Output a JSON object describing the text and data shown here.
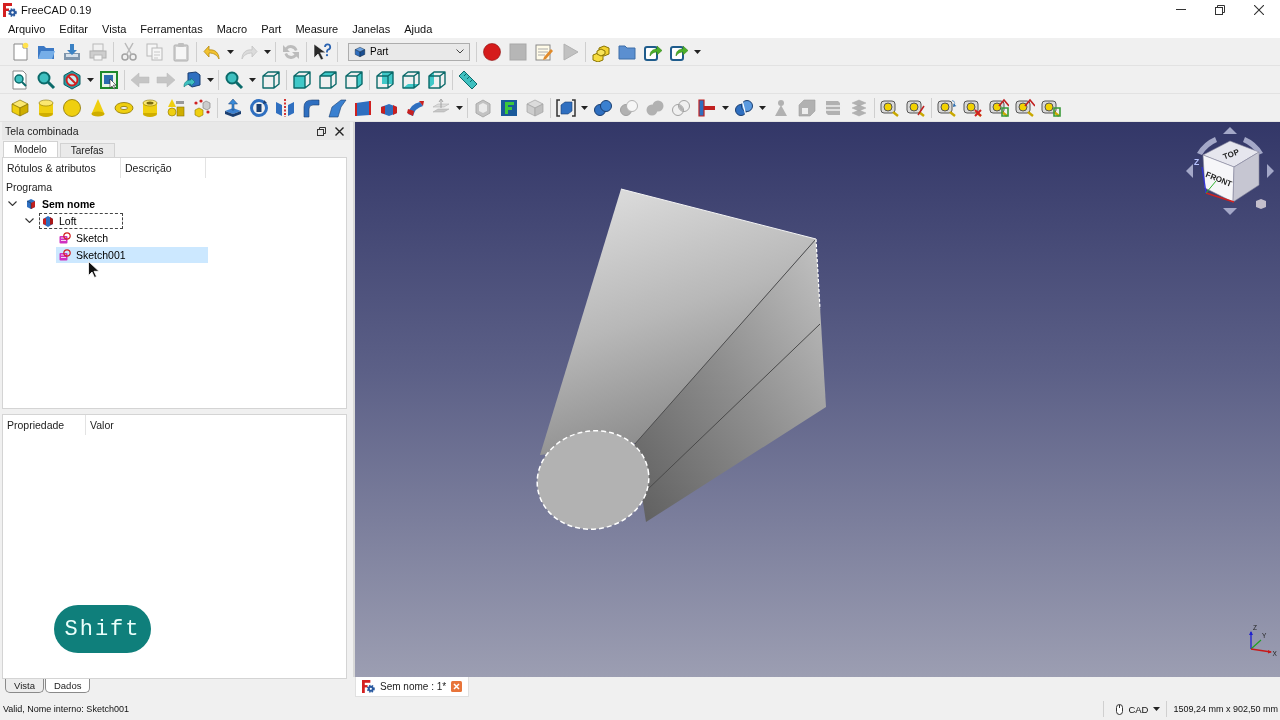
{
  "window": {
    "title": "FreeCAD 0.19"
  },
  "menu": [
    "Arquivo",
    "Editar",
    "Vista",
    "Ferramentas",
    "Macro",
    "Part",
    "Measure",
    "Janelas",
    "Ajuda"
  ],
  "toolbars": [
    {
      "groups": [
        {
          "kind": "tools",
          "items": [
            {
              "disabled": false,
              "dropdown": false
            },
            {
              "disabled": false,
              "dropdown": false
            },
            {
              "disabled": false,
              "dropdown": false
            },
            {
              "disabled": true,
              "dropdown": false
            }
          ]
        },
        {
          "kind": "tools",
          "items": [
            {
              "disabled": true,
              "dropdown": false
            },
            {
              "disabled": true,
              "dropdown": false
            },
            {
              "disabled": true,
              "dropdown": false
            }
          ]
        },
        {
          "kind": "tools",
          "items": [
            {
              "disabled": false,
              "dropdown": true
            },
            {
              "disabled": true,
              "dropdown": true
            }
          ]
        },
        {
          "kind": "tools",
          "items": [
            {
              "disabled": true,
              "dropdown": false
            }
          ]
        },
        {
          "kind": "tools",
          "items": [
            {
              "disabled": false,
              "dropdown": false
            }
          ]
        },
        {
          "kind": "combo",
          "value": "Part"
        },
        {
          "kind": "tools",
          "items": [
            {
              "disabled": false,
              "dropdown": false
            },
            {
              "disabled": true,
              "dropdown": false
            },
            {
              "disabled": false,
              "dropdown": false
            },
            {
              "disabled": true,
              "dropdown": false
            }
          ]
        },
        {
          "kind": "tools",
          "items": [
            {
              "disabled": false,
              "dropdown": false
            },
            {
              "disabled": false,
              "dropdown": false
            },
            {
              "disabled": false,
              "dropdown": false
            },
            {
              "disabled": false,
              "dropdown": true
            }
          ]
        }
      ]
    },
    {
      "groups": [
        {
          "kind": "tools",
          "items": [
            {
              "disabled": false,
              "dropdown": false
            },
            {
              "disabled": false,
              "dropdown": false
            },
            {
              "disabled": false,
              "dropdown": true
            },
            {
              "disabled": false,
              "dropdown": false
            }
          ]
        },
        {
          "kind": "tools",
          "items": [
            {
              "disabled": true,
              "dropdown": false
            },
            {
              "disabled": true,
              "dropdown": false
            },
            {
              "disabled": false,
              "dropdown": true
            }
          ]
        },
        {
          "kind": "tools",
          "items": [
            {
              "disabled": false,
              "dropdown": true
            },
            {
              "disabled": false,
              "dropdown": false
            }
          ]
        },
        {
          "kind": "tools",
          "items": [
            {
              "disabled": false,
              "dropdown": false
            },
            {
              "disabled": false,
              "dropdown": false
            },
            {
              "disabled": false,
              "dropdown": false
            }
          ]
        },
        {
          "kind": "tools",
          "items": [
            {
              "disabled": false,
              "dropdown": false
            },
            {
              "disabled": false,
              "dropdown": false
            },
            {
              "disabled": false,
              "dropdown": false
            }
          ]
        },
        {
          "kind": "tools",
          "items": [
            {
              "disabled": false,
              "dropdown": false
            }
          ]
        }
      ]
    },
    {
      "groups": [
        {
          "kind": "tools",
          "items": [
            {
              "disabled": false,
              "dropdown": false
            },
            {
              "disabled": false,
              "dropdown": false
            },
            {
              "disabled": false,
              "dropdown": false
            },
            {
              "disabled": false,
              "dropdown": false
            },
            {
              "disabled": false,
              "dropdown": false
            },
            {
              "disabled": false,
              "dropdown": false
            },
            {
              "disabled": false,
              "dropdown": false
            },
            {
              "disabled": false,
              "dropdown": false
            }
          ]
        },
        {
          "kind": "tools",
          "items": [
            {
              "disabled": false,
              "dropdown": false
            },
            {
              "disabled": false,
              "dropdown": false
            },
            {
              "disabled": false,
              "dropdown": false
            },
            {
              "disabled": false,
              "dropdown": false
            },
            {
              "disabled": false,
              "dropdown": false
            },
            {
              "disabled": false,
              "dropdown": false
            },
            {
              "disabled": false,
              "dropdown": false
            },
            {
              "disabled": false,
              "dropdown": false
            },
            {
              "disabled": true,
              "dropdown": true
            }
          ]
        },
        {
          "kind": "tools",
          "items": [
            {
              "disabled": true,
              "dropdown": false
            },
            {
              "disabled": false,
              "dropdown": false
            },
            {
              "disabled": true,
              "dropdown": false
            }
          ]
        },
        {
          "kind": "tools",
          "items": [
            {
              "disabled": false,
              "dropdown": true
            },
            {
              "disabled": false,
              "dropdown": false
            },
            {
              "disabled": true,
              "dropdown": false
            },
            {
              "disabled": true,
              "dropdown": false
            },
            {
              "disabled": true,
              "dropdown": false
            },
            {
              "disabled": false,
              "dropdown": true
            },
            {
              "disabled": false,
              "dropdown": true
            },
            {
              "disabled": true,
              "dropdown": false
            },
            {
              "disabled": true,
              "dropdown": false
            },
            {
              "disabled": true,
              "dropdown": false
            },
            {
              "disabled": true,
              "dropdown": false
            }
          ]
        },
        {
          "kind": "tools",
          "items": [
            {
              "disabled": false,
              "dropdown": false
            },
            {
              "disabled": false,
              "dropdown": false
            }
          ]
        },
        {
          "kind": "tools",
          "items": [
            {
              "disabled": false,
              "dropdown": false
            },
            {
              "disabled": false,
              "dropdown": false
            },
            {
              "disabled": false,
              "dropdown": false
            },
            {
              "disabled": false,
              "dropdown": false
            },
            {
              "disabled": false,
              "dropdown": false
            }
          ]
        }
      ]
    }
  ],
  "combo_view": {
    "title": "Tela combinada",
    "tabs": [
      {
        "label": "Modelo",
        "selected": true
      },
      {
        "label": "Tarefas",
        "selected": false
      }
    ],
    "tree": {
      "columns": [
        "Rótulos & atributos",
        "Descrição"
      ],
      "section": "Programa",
      "items": [
        {
          "kind": "document",
          "label": "Sem nome",
          "selected": false,
          "expanded": true,
          "children": [
            {
              "kind": "feature",
              "label": "Loft",
              "selected": false,
              "focused": true,
              "expanded": true,
              "children": [
                {
                  "kind": "sketch",
                  "label": "Sketch",
                  "selected": false
                },
                {
                  "kind": "sketch",
                  "label": "Sketch001",
                  "selected": true
                }
              ]
            }
          ]
        }
      ]
    },
    "properties": {
      "columns": [
        "Propriedade",
        "Valor"
      ],
      "tabs": [
        {
          "label": "Vista",
          "selected": false
        },
        {
          "label": "Dados",
          "selected": true
        }
      ]
    }
  },
  "key_overlay": {
    "label": "Shift"
  },
  "viewport": {
    "navigation_cube": {
      "faces": [
        "TOP",
        "FRONT"
      ],
      "axis": "Z"
    },
    "axis_cross": {
      "labels": [
        "Z",
        "Y",
        "X"
      ]
    }
  },
  "document_tabs": [
    {
      "label": "Sem nome : 1*",
      "selected": true
    }
  ],
  "status_bar": {
    "message": "Valid, Nome interno: Sketch001",
    "navigation_style": "CAD",
    "dimensions": "1509,24 mm x 902,50 mm"
  }
}
